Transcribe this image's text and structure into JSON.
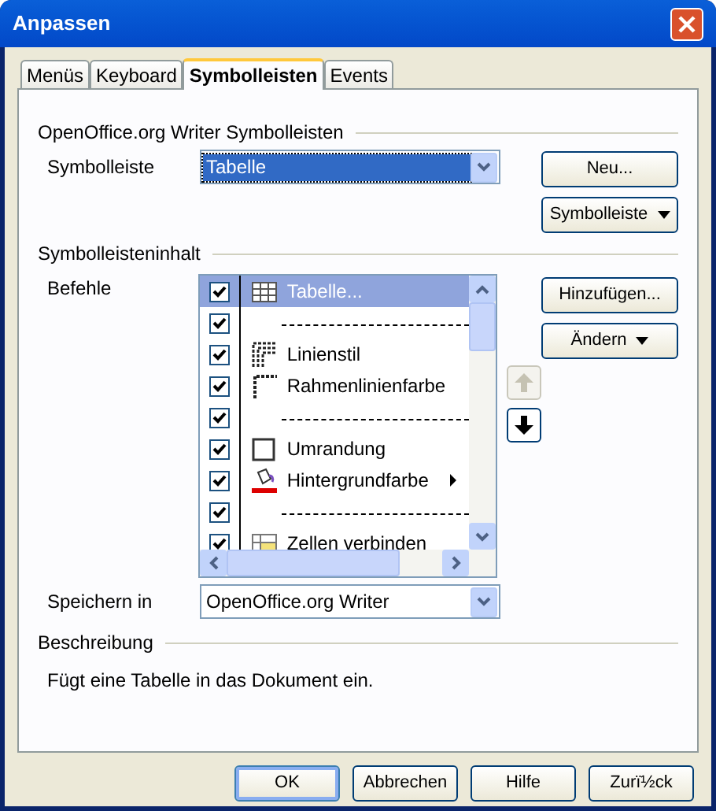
{
  "window": {
    "title": "Anpassen"
  },
  "tabs": [
    {
      "label": "Menüs",
      "selected": false
    },
    {
      "label": "Keyboard",
      "selected": false
    },
    {
      "label": "Symbolleisten",
      "selected": true
    },
    {
      "label": "Events",
      "selected": false
    }
  ],
  "toolbars_group": {
    "heading": "OpenOffice.org Writer Symbolleisten",
    "label": "Symbolleiste",
    "value": "Tabelle",
    "buttons": [
      {
        "label": "Neu...",
        "dropdown": false
      },
      {
        "label": "Symbolleiste",
        "dropdown": true
      }
    ]
  },
  "content_group": {
    "heading": "Symbolleisteninhalt",
    "label": "Befehle",
    "commands": [
      {
        "kind": "command",
        "label": "Tabelle...",
        "checked": true,
        "selected": true,
        "submenu": false
      },
      {
        "kind": "separator",
        "checked": true,
        "selected": false
      },
      {
        "kind": "command",
        "label": "Linienstil",
        "checked": true,
        "selected": false,
        "submenu": false
      },
      {
        "kind": "command",
        "label": "Rahmenlinienfarbe",
        "checked": true,
        "selected": false,
        "submenu": false
      },
      {
        "kind": "separator",
        "checked": true,
        "selected": false
      },
      {
        "kind": "command",
        "label": "Umrandung",
        "checked": true,
        "selected": false,
        "submenu": false
      },
      {
        "kind": "command",
        "label": "Hintergrundfarbe",
        "checked": true,
        "selected": false,
        "submenu": true
      },
      {
        "kind": "separator",
        "checked": true,
        "selected": false
      },
      {
        "kind": "command",
        "label": "Zellen verbinden",
        "checked": true,
        "selected": false,
        "submenu": false
      }
    ],
    "buttons": [
      {
        "label": "Hinzufügen...",
        "dropdown": false
      },
      {
        "label": "Ändern",
        "dropdown": true
      }
    ],
    "move_up": {
      "disabled": true
    },
    "move_down": {
      "disabled": false
    },
    "save_label": "Speichern in",
    "save_value": "OpenOffice.org Writer"
  },
  "description": {
    "heading": "Beschreibung",
    "text": "Fügt eine Tabelle in das Dokument ein."
  },
  "footer_buttons": [
    {
      "label": "OK",
      "default": true
    },
    {
      "label": "Abbrechen",
      "default": false
    },
    {
      "label": "Hilfe",
      "default": false
    },
    {
      "label": "Zurï½ck",
      "default": false
    }
  ]
}
